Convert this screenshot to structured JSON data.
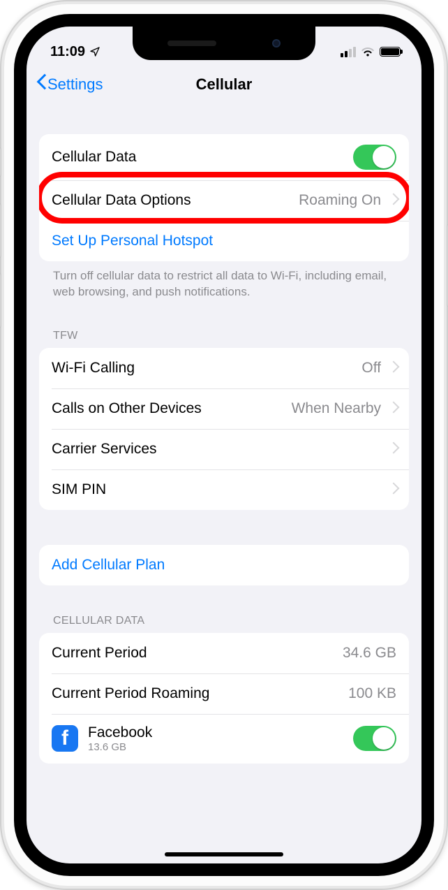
{
  "status": {
    "time": "11:09",
    "location_arrow": "➤"
  },
  "nav": {
    "back": "Settings",
    "title": "Cellular"
  },
  "group1": {
    "cellular_data_label": "Cellular Data",
    "cellular_data_on": true,
    "options_label": "Cellular Data Options",
    "options_value": "Roaming On",
    "hotspot_label": "Set Up Personal Hotspot",
    "footer": "Turn off cellular data to restrict all data to Wi-Fi, including email, web browsing, and push notifications."
  },
  "group2": {
    "header": "TFW",
    "wifi_calling_label": "Wi-Fi Calling",
    "wifi_calling_value": "Off",
    "calls_other_label": "Calls on Other Devices",
    "calls_other_value": "When Nearby",
    "carrier_services_label": "Carrier Services",
    "sim_pin_label": "SIM PIN"
  },
  "group3": {
    "add_plan_label": "Add Cellular Plan"
  },
  "group4": {
    "header": "CELLULAR DATA",
    "current_period_label": "Current Period",
    "current_period_value": "34.6 GB",
    "roaming_label": "Current Period Roaming",
    "roaming_value": "100 KB",
    "app_name": "Facebook",
    "app_usage": "13.6 GB",
    "app_toggle_on": true
  }
}
